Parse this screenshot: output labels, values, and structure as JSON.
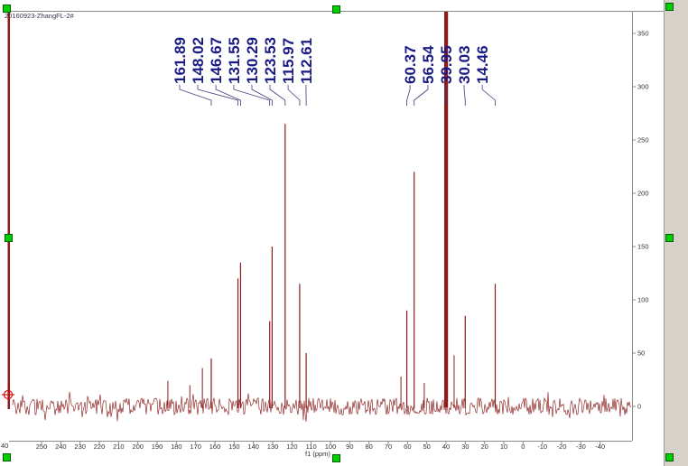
{
  "chart_data": {
    "type": "line",
    "subtype": "nmr-spectrum",
    "title": "20160923-ZhangFL-2#",
    "xlabel": "f1 (ppm)",
    "x_axis": {
      "unit": "ppm",
      "reversed": true,
      "ticks": [
        250,
        240,
        230,
        220,
        210,
        200,
        190,
        180,
        170,
        160,
        150,
        140,
        130,
        120,
        110,
        100,
        90,
        80,
        70,
        60,
        50,
        40,
        30,
        20,
        10,
        0,
        -10,
        -20,
        -30,
        -40
      ],
      "edge_label": "40"
    },
    "y_axis": {
      "ticks": [
        350,
        300,
        250,
        200,
        150,
        100,
        50,
        0
      ],
      "baseline": 0
    },
    "peaks": [
      {
        "ppm": 161.89,
        "intensity": 45,
        "label": "161.89",
        "label_ppm": 178.3
      },
      {
        "ppm": 148.02,
        "intensity": 120,
        "label": "148.02",
        "label_ppm": 168.9
      },
      {
        "ppm": 146.67,
        "intensity": 135,
        "label": "146.67",
        "label_ppm": 159.5
      },
      {
        "ppm": 131.55,
        "intensity": 80,
        "label": "131.55",
        "label_ppm": 150.2
      },
      {
        "ppm": 130.29,
        "intensity": 150,
        "label": "130.29",
        "label_ppm": 140.8
      },
      {
        "ppm": 123.53,
        "intensity": 265,
        "label": "123.53",
        "label_ppm": 131.4
      },
      {
        "ppm": 115.97,
        "intensity": 115,
        "label": "115.97",
        "label_ppm": 122.0
      },
      {
        "ppm": 112.61,
        "intensity": 50,
        "label": "112.61",
        "label_ppm": 112.7
      },
      {
        "ppm": 60.37,
        "intensity": 90,
        "label": "60.37",
        "label_ppm": 58.7
      },
      {
        "ppm": 56.54,
        "intensity": 220,
        "label": "56.54",
        "label_ppm": 49.4
      },
      {
        "ppm": 39.95,
        "intensity": 400,
        "label": "39.95",
        "label_ppm": 40.0,
        "off_scale": true
      },
      {
        "ppm": 30.03,
        "intensity": 85,
        "label": "30.03",
        "label_ppm": 30.6
      },
      {
        "ppm": 14.46,
        "intensity": 115,
        "label": "14.46",
        "label_ppm": 21.2
      }
    ],
    "minor_peaks": [
      {
        "ppm": 184.4,
        "intensity": 24
      },
      {
        "ppm": 173.0,
        "intensity": 20
      },
      {
        "ppm": 166.5,
        "intensity": 36
      },
      {
        "ppm": 63.4,
        "intensity": 28
      },
      {
        "ppm": 51.3,
        "intensity": 22
      },
      {
        "ppm": 35.8,
        "intensity": 48
      }
    ],
    "noise": {
      "amplitude_units": 8,
      "baseline_value": 0
    },
    "has_left_cutoff_line": true
  },
  "colors": {
    "trace": "#8b1d1d",
    "peak_label_text": "#1a1a85",
    "leader_line": "#3c3c78",
    "axis_line": "#8a8a8a",
    "axis_text": "#333333",
    "selection_handle": "#00d000",
    "selection_handle_border": "#005c00",
    "marker": "#cc1111",
    "side_panel": "#d6d2ca"
  },
  "icons": {
    "reference_marker": "crosshair-circle",
    "selection_handle": "green-square"
  }
}
